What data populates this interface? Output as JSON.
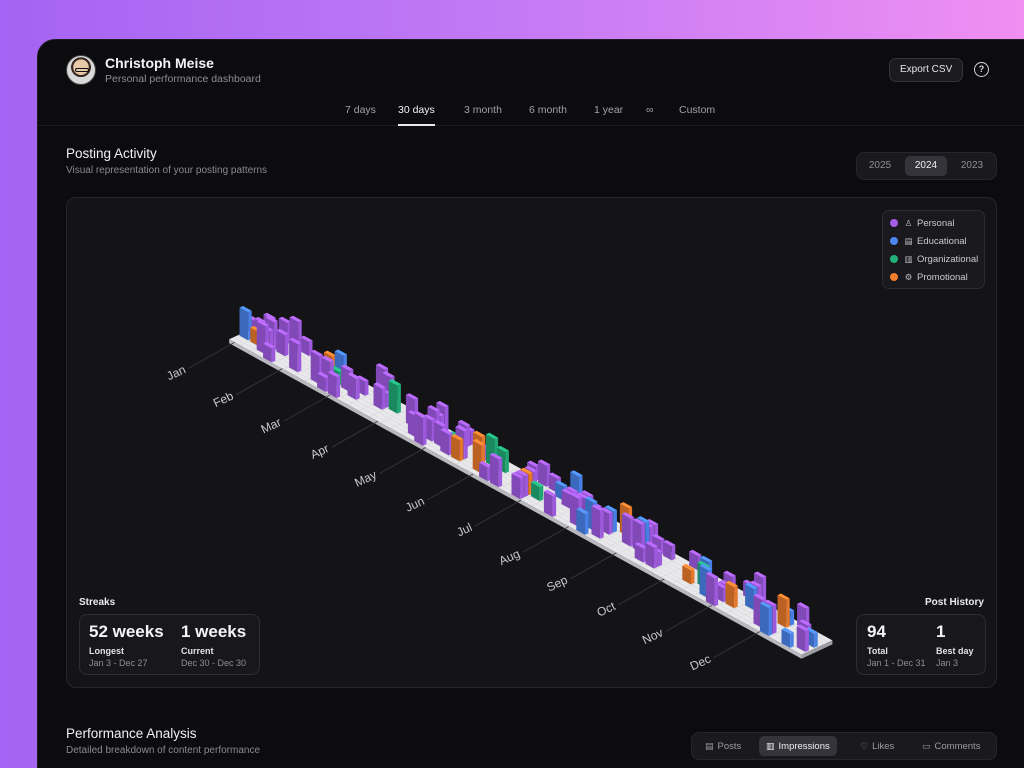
{
  "user": {
    "name": "Christoph Meise",
    "subtitle": "Personal performance dashboard"
  },
  "actions": {
    "export_label": "Export CSV",
    "help_glyph": "?"
  },
  "range_tabs": [
    "7 days",
    "30 days",
    "3 month",
    "6 month",
    "1 year",
    "∞",
    "Custom"
  ],
  "range_active": "30 days",
  "posting": {
    "title": "Posting Activity",
    "subtitle": "Visual representation of your posting patterns",
    "years": [
      "2025",
      "2024",
      "2023"
    ],
    "year_active": "2024",
    "months": [
      "Jan",
      "Feb",
      "Mar",
      "Apr",
      "May",
      "Jun",
      "Jul",
      "Aug",
      "Sep",
      "Oct",
      "Nov",
      "Dec"
    ],
    "legend": [
      {
        "label": "Personal",
        "color": "#a45ee8",
        "icon": "person-icon"
      },
      {
        "label": "Educational",
        "color": "#4c86f0",
        "icon": "book-icon"
      },
      {
        "label": "Organizational",
        "color": "#22b07a",
        "icon": "building-icon"
      },
      {
        "label": "Promotional",
        "color": "#f07d2c",
        "icon": "megaphone-icon"
      }
    ],
    "streaks": {
      "label": "Streaks",
      "longest_value": "52 weeks",
      "longest_label": "Longest",
      "longest_range": "Jan 3 - Dec 27",
      "current_value": "1 weeks",
      "current_label": "Current",
      "current_range": "Dec 30 - Dec 30"
    },
    "history": {
      "label": "Post History",
      "total_value": "94",
      "total_label": "Total",
      "total_range": "Jan 1 - Dec 31",
      "best_value": "1",
      "best_label": "Best day",
      "best_range": "Jan 3"
    }
  },
  "performance": {
    "title": "Performance Analysis",
    "subtitle": "Detailed breakdown of content performance",
    "metrics": [
      {
        "label": "Posts",
        "icon": "document-icon"
      },
      {
        "label": "Impressions",
        "icon": "bar-chart-icon"
      },
      {
        "label": "Likes",
        "icon": "thumbs-up-icon"
      },
      {
        "label": "Comments",
        "icon": "comment-icon"
      }
    ],
    "metric_active": "Impressions"
  }
}
